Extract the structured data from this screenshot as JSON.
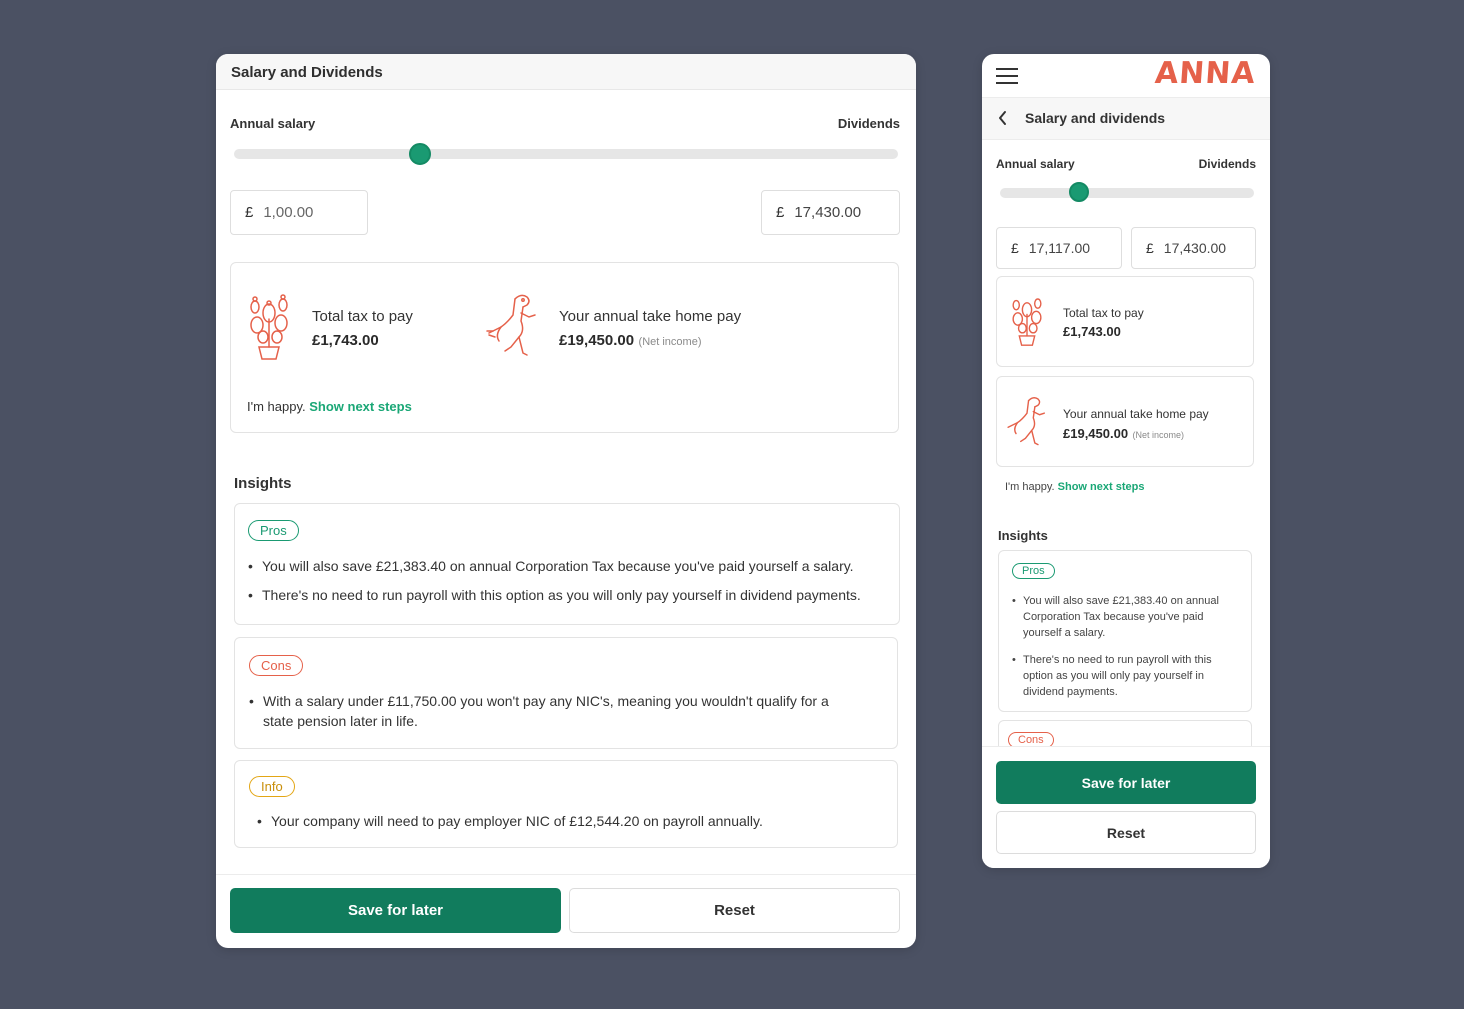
{
  "desktop": {
    "header_title": "Salary and Dividends",
    "slider": {
      "left_label": "Annual salary",
      "right_label": "Dividends",
      "position_fraction": 0.28
    },
    "salary_input": {
      "currency": "£",
      "placeholder": "1,00.00"
    },
    "dividends_input": {
      "currency": "£",
      "value": "17,430.00"
    },
    "summary": {
      "tax_label": "Total tax to pay",
      "tax_value": "£1,743.00",
      "home_label": "Your annual take home pay",
      "home_value": "£19,450.00",
      "home_note": "(Net income)",
      "happy_text": "I'm happy.",
      "next_steps_link": "Show next steps"
    },
    "insights_title": "Insights",
    "pros": {
      "tag": "Pros",
      "items": [
        "You will also save £21,383.40 on annual Corporation Tax because you've paid yourself a salary.",
        "There's no need to run payroll with this option as you will only pay yourself in dividend payments."
      ]
    },
    "cons": {
      "tag": "Cons",
      "items": [
        "With a salary under £11,750.00 you won't pay any NIC's, meaning you wouldn't qualify for a state pension later in life."
      ]
    },
    "info": {
      "tag": "Info",
      "items": [
        "Your company will need to pay employer NIC of £12,544.20 on payroll annually."
      ]
    },
    "save_button": "Save for later",
    "reset_button": "Reset"
  },
  "mobile": {
    "logo": "ANNA",
    "sub_title": "Salary and dividends",
    "slider": {
      "left_label": "Annual salary",
      "right_label": "Dividends",
      "position_fraction": 0.31
    },
    "salary_input": {
      "currency": "£",
      "value": "17,117.00"
    },
    "dividends_input": {
      "currency": "£",
      "value": "17,430.00"
    },
    "tax_label": "Total tax to pay",
    "tax_value": "£1,743.00",
    "home_label": "Your annual take home pay",
    "home_value": "£19,450.00",
    "home_note": "(Net income)",
    "happy_text": "I'm happy.",
    "next_steps_link": "Show next steps",
    "insights_title": "Insights",
    "pros_tag": "Pros",
    "pros_items": [
      "You will also save £21,383.40 on annual Corporation Tax because you've paid yourself a salary.",
      "There's no need to run payroll with this option as you will only pay yourself in dividend payments."
    ],
    "cons_tag": "Cons",
    "save_button": "Save for later",
    "reset_button": "Reset"
  },
  "colors": {
    "background": "#4b5163",
    "accent_green": "#117c5d",
    "slider_thumb": "#1a9a72",
    "link_green": "#1aa776",
    "brand_orange": "#e5614a",
    "info_amber": "#e3a615"
  },
  "icons": [
    "cactus-icon",
    "dinosaur-icon",
    "hamburger-menu-icon",
    "back-chevron-icon"
  ]
}
